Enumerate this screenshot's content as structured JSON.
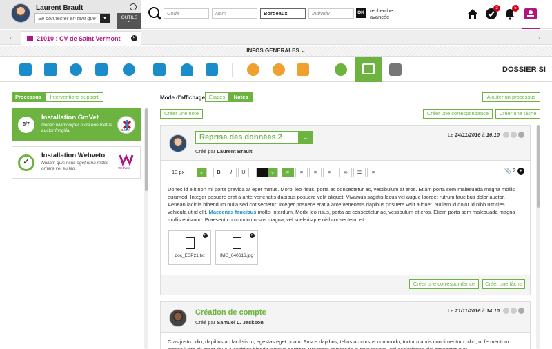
{
  "user": {
    "name": "Laurent Brault",
    "connect_placeholder": "Se connecter en tant que",
    "outils_label": "OUTILS"
  },
  "search": {
    "code_placeholder": "Code",
    "nom_placeholder": "Nom",
    "ville_value": "Bordeaux",
    "individu_placeholder": "Individu",
    "ok_label": "OK",
    "advanced_line1": "recherche",
    "advanced_line2": "avancée"
  },
  "notifications": {
    "tasks_count": "3",
    "alerts_count": "5"
  },
  "tab": {
    "label": "21010 : CV de Saint Vermont"
  },
  "section": {
    "label": "INFOS GENERALES",
    "dossier_title": "DOSSIER SI"
  },
  "left": {
    "tabs": [
      "Processus",
      "Interventions support"
    ],
    "processes": [
      {
        "progress": "5/7",
        "title": "Installation GmVet",
        "desc": "Donec ullamcorper nulla non metus auctor fringilla.",
        "logo": "GmVet"
      },
      {
        "progress": "",
        "title": "Installation Webveto",
        "desc": "Nullam quis risus eget urna mollis ornare vel eu leo.",
        "logo": "WebVeto"
      }
    ]
  },
  "right": {
    "mode_label": "Mode d'affichage",
    "mode_options": [
      "Etapes",
      "Notes"
    ],
    "add_process": "Ajouter un processus",
    "create_note": "Créer une note",
    "create_correspondance": "Créer une correspondance",
    "create_task": "Créer une tâche",
    "notes": [
      {
        "title": "Reprise des données 2",
        "created_prefix": "Créé par",
        "author": "Laurent Brault",
        "date_prefix": "Le",
        "date": "24/11/2016",
        "date_sep": "à",
        "time": "16:10",
        "font_size": "13 px",
        "attachments_count": "2",
        "body_part1": "Donec id elit non mi porta gravida at eget metus. Morbi leo risus, porta ac consectetur ac, vestibulum at eros. Etiam porta sem malesuada magna mollis euismod. Integer posuere erat a ante venenatis dapibus posuere velit aliquet.  Vivamus sagittis lacus vel augue laoreet rutrum faucibus dolor auctor. Aenean lacinia bibendum nulla sed consectetur. Integer posuere erat a ante venenatis dapibus posuere velit aliquet. Nullam id dolor id nibh ultricies vehicula ut id elit.",
        "body_link": "Maecenas faucibus",
        "body_part2": "mollis interdum. Morbi leo risus, porta ac consectetur ac, vestibulum at eros. Etiam porta sem malesuada magna mollis euismod. Praesent commodo cursus magna, vel scelerisque nisl consectetur et.",
        "files": [
          "doc_ESP21.txt",
          "IMG_040616.jpg"
        ],
        "btn_correspondance": "Créer une correspondance",
        "btn_task": "Créer une tâche"
      },
      {
        "title": "Création de compte",
        "created_prefix": "Créé par",
        "author": "Samuel L. Jackson",
        "date_prefix": "Le",
        "date": "21/11/2016",
        "date_sep": "à",
        "time": "14:10",
        "body": "Cras justo odio, dapibus ac facilisis in, egestas eget quam. Fusce dapibus, tellus ac cursus commodo, tortor mauris condimentum nibh, ut fermentum massa justo sit amet risus. Curabitur blandit tempus porttitor. Praesent commodo cursus magna, vel scelerisque nisl consectetur et."
      }
    ]
  },
  "colors": {
    "green": "#6cb33f",
    "magenta": "#b0177e",
    "blue": "#1a8cc9",
    "red": "#d0021b"
  }
}
